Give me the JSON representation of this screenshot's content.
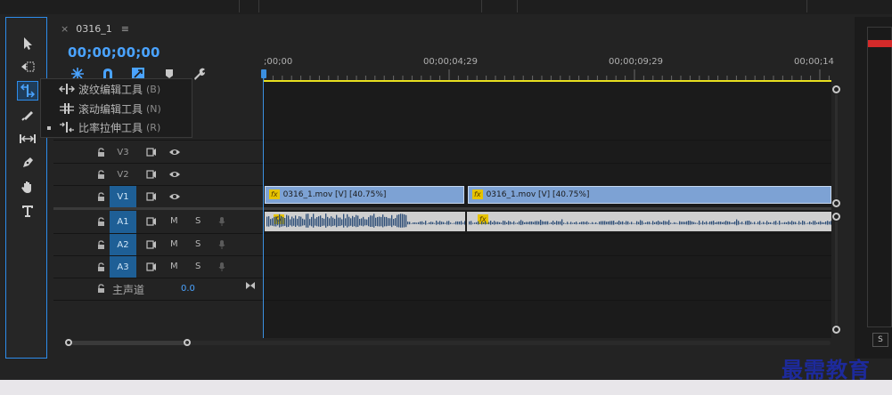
{
  "sequence": {
    "tab_close": "×",
    "tab_name": "0316_1",
    "tab_menu": "≡",
    "timecode": "00;00;00;00"
  },
  "ruler": {
    "labels": [
      ";00;00",
      "00;00;04;29",
      "00;00;09;29",
      "00;00;14"
    ]
  },
  "tools": [
    "selection-tool",
    "track-select-tool",
    "ripple-edit-tool",
    "razor-tool",
    "slip-tool",
    "pen-tool",
    "hand-tool",
    "type-tool"
  ],
  "tool_popup": {
    "items": [
      {
        "label": "波纹编辑工具",
        "shortcut": "(B)"
      },
      {
        "label": "滚动编辑工具",
        "shortcut": "(N)"
      },
      {
        "label": "比率拉伸工具",
        "shortcut": "(R)"
      }
    ]
  },
  "video_tracks": [
    {
      "label": "V3",
      "target": false
    },
    {
      "label": "V2",
      "target": false
    },
    {
      "label": "V1",
      "target": true
    }
  ],
  "audio_tracks": [
    {
      "label": "A1",
      "m": "M",
      "s": "S"
    },
    {
      "label": "A2",
      "m": "M",
      "s": "S"
    },
    {
      "label": "A3",
      "m": "M",
      "s": "S"
    }
  ],
  "master": {
    "label": "主声道",
    "value": "0.0"
  },
  "clips": {
    "fx_badge": "fx",
    "v1": [
      "0316_1.mov [V] [40.75%]",
      "0316_1.mov [V] [40.75%]"
    ]
  },
  "right_panel": {
    "solo": "S"
  },
  "watermark": "最需教育",
  "colors": {
    "accent": "#2d8ceb",
    "timecode": "#4aa3ff",
    "video_clip": "#7da2d4",
    "work_area": "#e8e020",
    "meter_peak": "#d42a2a"
  }
}
